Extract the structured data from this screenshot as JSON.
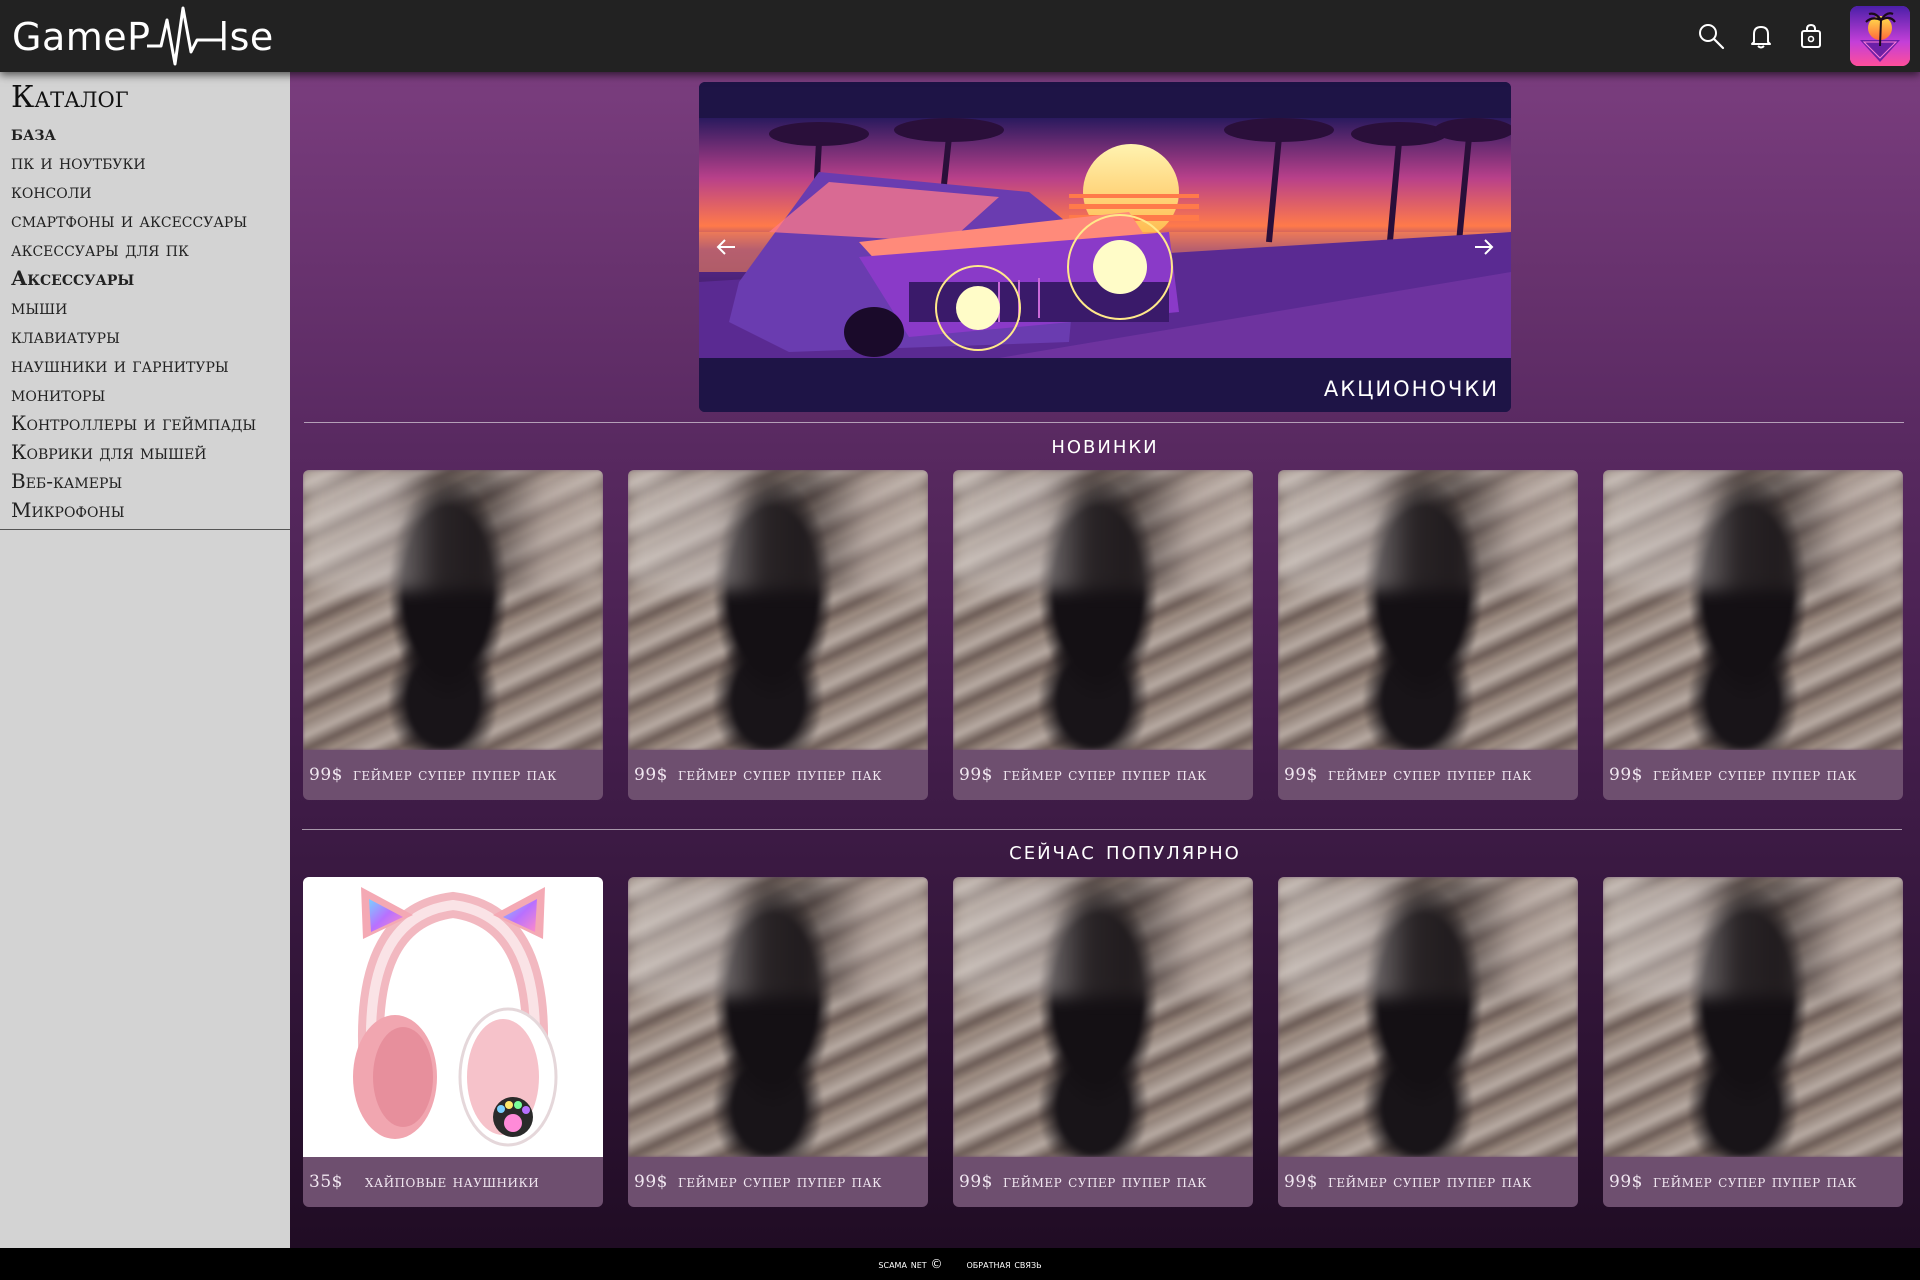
{
  "header": {
    "logo_part1": "GameP",
    "logo_part2": "lse",
    "icons": [
      "search-icon",
      "bell-icon",
      "shopping-bag-icon"
    ],
    "avatar": "palm-sunset-avatar"
  },
  "sidebar": {
    "title": "Каталог",
    "items": [
      {
        "label": "база",
        "bold": true
      },
      {
        "label": "пк и ноутбуки",
        "bold": false
      },
      {
        "label": "консоли",
        "bold": false
      },
      {
        "label": "смартфоны и  аксессуары",
        "bold": false
      },
      {
        "label": "аксессуары для пк",
        "bold": false
      },
      {
        "label": "Аксессуары",
        "bold": true
      },
      {
        "label": "мыши",
        "bold": false
      },
      {
        "label": "клавиатуры",
        "bold": false
      },
      {
        "label": "наушники и гарнитуры",
        "bold": false
      },
      {
        "label": "мониторы",
        "bold": false
      },
      {
        "label": "Контроллеры и геймпады",
        "bold": false
      },
      {
        "label": "Коврики для мышей",
        "bold": false
      },
      {
        "label": "Веб-камеры",
        "bold": false
      },
      {
        "label": "Микрофоны",
        "bold": false
      }
    ]
  },
  "banner": {
    "caption": "акционочки",
    "prev_icon": "arrow-left-icon",
    "next_icon": "arrow-right-icon"
  },
  "sections": {
    "new": {
      "title": "новинки",
      "products": [
        {
          "price": "99$",
          "name": "геймер супер  пупер пак"
        },
        {
          "price": "99$",
          "name": "геймер супер  пупер пак"
        },
        {
          "price": "99$",
          "name": "геймер супер  пупер пак"
        },
        {
          "price": "99$",
          "name": "геймер супер  пупер пак"
        },
        {
          "price": "99$",
          "name": "геймер супер  пупер пак"
        }
      ]
    },
    "popular": {
      "title": "сейчас популярно",
      "products": [
        {
          "price": "35$",
          "name": "хайповые наушники"
        },
        {
          "price": "99$",
          "name": "геймер супер  пупер пак"
        },
        {
          "price": "99$",
          "name": "геймер супер  пупер пак"
        },
        {
          "price": "99$",
          "name": "геймер супер  пупер пак"
        },
        {
          "price": "99$",
          "name": "геймер супер  пупер пак"
        }
      ]
    }
  },
  "footer": {
    "copyright": "scama net ©",
    "feedback": "обратная связь"
  },
  "colors": {
    "header_bg": "#222222",
    "sidebar_bg": "#d3d3d3",
    "main_gradient_top": "#7a3d7e",
    "main_gradient_bottom": "#200c24",
    "card_label_bg": "#6e4f6f",
    "footer_bg": "#000000"
  }
}
